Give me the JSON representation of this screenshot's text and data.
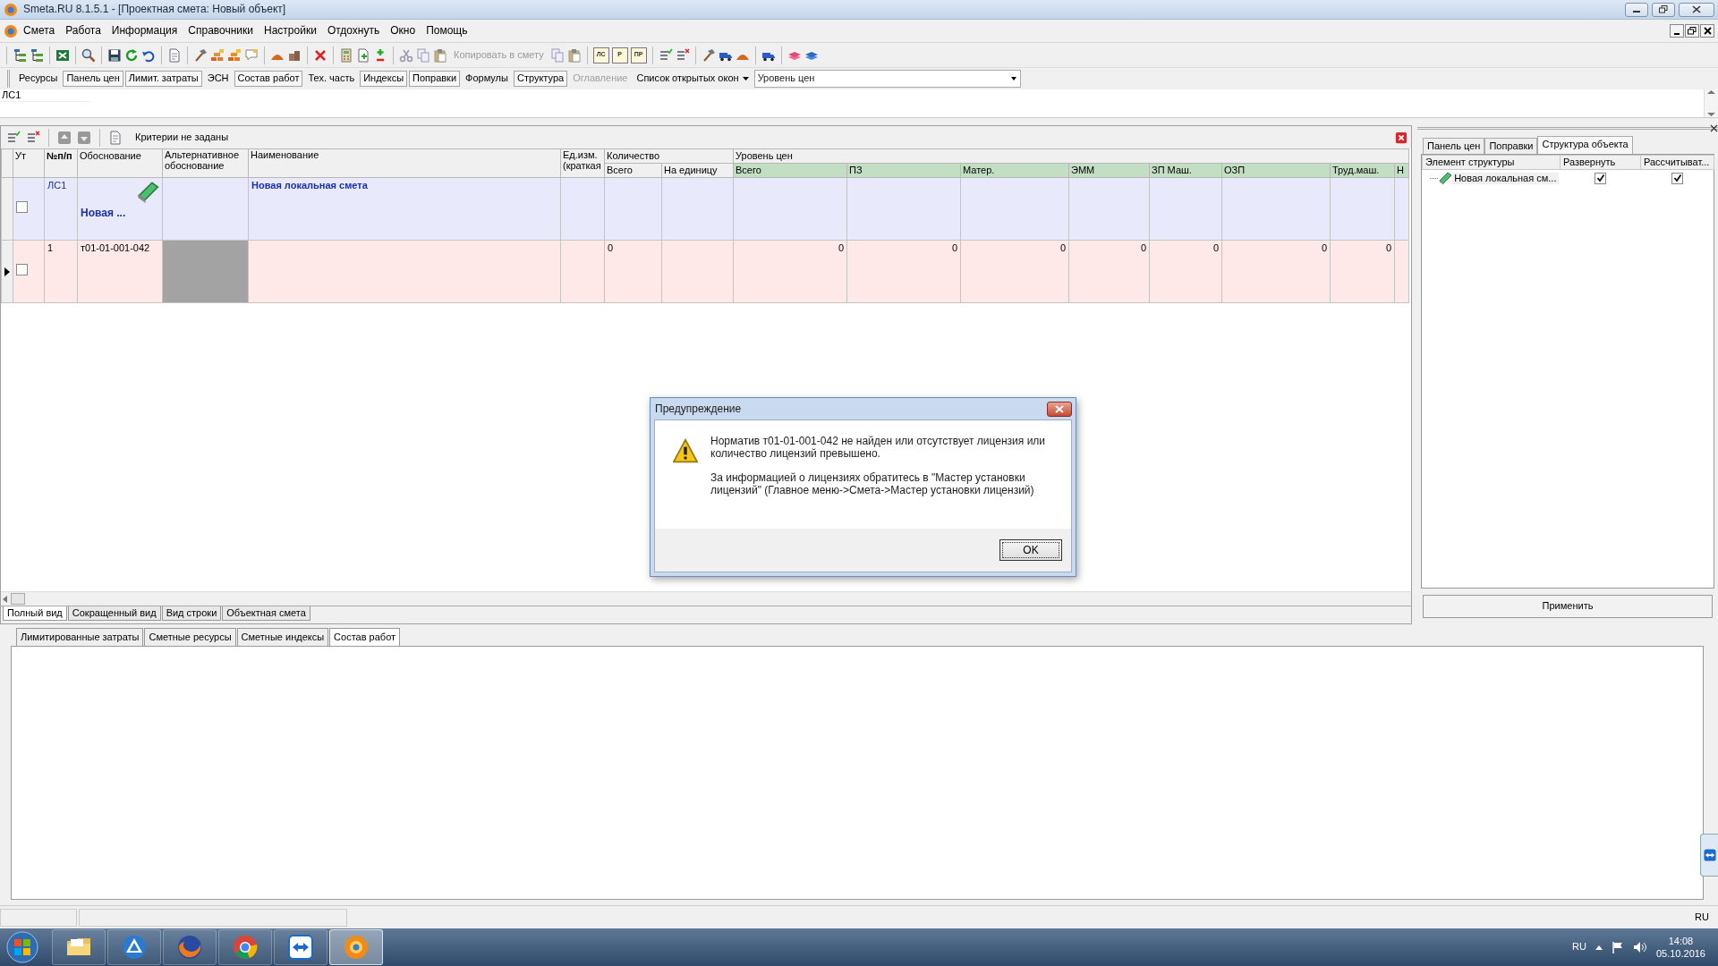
{
  "window": {
    "title": "Smeta.RU  8.1.5.1   - [Проектная смета: Новый объект]"
  },
  "menu": [
    "Смета",
    "Работа",
    "Информация",
    "Справочники",
    "Настройки",
    "Отдохнуть",
    "Окно",
    "Помощь"
  ],
  "toolbar": {
    "copy_button": {
      "label": "Копировать в смету",
      "disabled": true
    },
    "doc_buttons": [
      "ЛС",
      "Р",
      "ПР"
    ]
  },
  "panel_buttons": [
    {
      "label": "Ресурсы",
      "pressed": false,
      "disabled": false
    },
    {
      "label": "Панель цен",
      "pressed": true,
      "disabled": false
    },
    {
      "label": "Лимит. затраты",
      "pressed": true,
      "disabled": false
    },
    {
      "label": "ЭСН",
      "pressed": false,
      "disabled": false
    },
    {
      "label": "Состав работ",
      "pressed": true,
      "disabled": false
    },
    {
      "label": "Тех. часть",
      "pressed": false,
      "disabled": false
    },
    {
      "label": "Индексы",
      "pressed": true,
      "disabled": false
    },
    {
      "label": "Поправки",
      "pressed": true,
      "disabled": false
    },
    {
      "label": "Формулы",
      "pressed": false,
      "disabled": false
    },
    {
      "label": "Структура",
      "pressed": true,
      "disabled": false
    },
    {
      "label": "Оглавление",
      "pressed": false,
      "disabled": true
    }
  ],
  "open_windows": {
    "label": "Список открытых окон"
  },
  "price_level": {
    "value": "Уровень цен"
  },
  "formula_bar": {
    "value": "ЛС1"
  },
  "grid": {
    "filter_label": "Критерии не заданы",
    "columns": [
      {
        "label": "Ут",
        "bold": false
      },
      {
        "label": "№п/п",
        "bold": true
      },
      {
        "label": "Обоснование",
        "bold": false
      },
      {
        "label": "Альтернативное обоснование",
        "bold": false
      },
      {
        "label": "Наименование",
        "bold": false
      },
      {
        "label": "Ед.изм. (краткая",
        "bold": false
      }
    ],
    "groups": [
      {
        "label": "Количество",
        "highlighted": false,
        "columns": [
          "Всего",
          "На единицу"
        ]
      },
      {
        "label": "Уровень цен",
        "highlighted": true,
        "columns": [
          "Всего",
          "ПЗ",
          "Матер.",
          "ЭММ",
          "ЗП Маш.",
          "ОЗП",
          "Труд.маш.",
          "Н"
        ]
      }
    ],
    "rows": [
      {
        "kind": "section",
        "current": false,
        "checked": false,
        "number": "ЛС1",
        "basis": "Новая ...",
        "alt_missing": false,
        "name": "Новая локальная смета",
        "quantity": "",
        "prices": []
      },
      {
        "kind": "item",
        "current": true,
        "checked": false,
        "number": "1",
        "basis": "т01-01-001-042",
        "alt_missing": true,
        "name": "",
        "quantity": "0",
        "prices": [
          "0",
          "0",
          "0",
          "0",
          "0",
          "0",
          "0"
        ]
      }
    ],
    "view_tabs": [
      {
        "label": "Полный вид",
        "selected": true
      },
      {
        "label": "Сокращенный вид",
        "selected": false
      },
      {
        "label": "Вид строки",
        "selected": false
      },
      {
        "label": "Объектная смета",
        "selected": false
      }
    ]
  },
  "side_panel": {
    "tabs": [
      {
        "label": "Панель цен",
        "selected": false
      },
      {
        "label": "Поправки",
        "selected": false
      },
      {
        "label": "Структура объекта",
        "selected": true
      }
    ],
    "columns": [
      "Элемент структуры",
      "Развернуть",
      "Рассчитыват..."
    ],
    "items": [
      {
        "label": "Новая локальная см...",
        "expand": true,
        "calculate": true
      }
    ],
    "apply_button": "Применить"
  },
  "lower_panel": {
    "tabs": [
      {
        "label": "Лимитированные затраты",
        "selected": false
      },
      {
        "label": "Сметные ресурсы",
        "selected": false
      },
      {
        "label": "Сметные индексы",
        "selected": false
      },
      {
        "label": "Состав работ",
        "selected": true
      }
    ]
  },
  "status_bar": {
    "language": "RU"
  },
  "taskbar": {
    "apps": [
      {
        "kind": "folder",
        "selected": false
      },
      {
        "kind": "triangle",
        "selected": false
      },
      {
        "kind": "globe",
        "selected": false
      },
      {
        "kind": "ring",
        "selected": false
      },
      {
        "kind": "arrows",
        "selected": false
      },
      {
        "kind": "app",
        "selected": true
      }
    ],
    "language": "RU",
    "time": "14:08",
    "date": "05.10.2016"
  },
  "dialog": {
    "title": "Предупреждение",
    "paragraphs": [
      "Норматив т01-01-001-042 не найден или отсутствует лицензия или количество лицензий превышено.",
      "За информацией о лицензиях обратитесь в \"Мастер установки лицензий\" (Главное меню->Смета->Мастер установки лицензий)"
    ],
    "button": "OK"
  }
}
